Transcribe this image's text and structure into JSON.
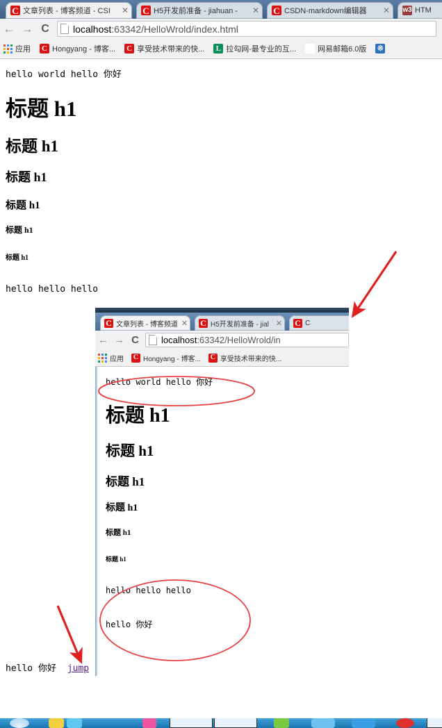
{
  "browser": {
    "tabs": [
      {
        "title": "文章列表 - 博客频道 - CSI",
        "icon": "csdn-favicon",
        "close": "✕",
        "active": true
      },
      {
        "title": "H5开发前准备 - jiahuan -",
        "icon": "csdn-favicon",
        "close": "✕",
        "active": false
      },
      {
        "title": "CSDN-markdown编辑器",
        "icon": "csdn-favicon",
        "close": "✕",
        "active": false
      },
      {
        "title": "HTM",
        "icon": "w3-favicon",
        "close": "✕",
        "active": false
      }
    ],
    "nav": {
      "back": "←",
      "forward": "→",
      "reload": "C"
    },
    "url_host": "localhost",
    "url_path": ":63342/HelloWrold/index.html",
    "url_full": "localhost:63342/HelloWrold/index.html",
    "bookmarks": [
      {
        "label": "应用",
        "icon": "apps-grid-icon"
      },
      {
        "label": "Hongyang - 博客...",
        "icon": "csdn-favicon"
      },
      {
        "label": "享受技术带来的快...",
        "icon": "csdn-favicon"
      },
      {
        "label": "拉勾网-最专业的互...",
        "icon": "lagou-favicon"
      },
      {
        "label": "网易邮箱6.0版",
        "icon": "netease-favicon"
      },
      {
        "label": "",
        "icon": "blue-favicon"
      }
    ]
  },
  "page": {
    "intro": "hello world hello 你好",
    "headings": [
      {
        "text": "标题 h1",
        "level": 1
      },
      {
        "text": "标题 h1",
        "level": 2
      },
      {
        "text": "标题 h1",
        "level": 3
      },
      {
        "text": "标题 h1",
        "level": 4
      },
      {
        "text": "标题 h1",
        "level": 5
      },
      {
        "text": "标题 h1",
        "level": 6
      }
    ],
    "para1": "hello hello hello",
    "footer_text": "hello 你好",
    "footer_link": "jump"
  },
  "inner_screenshot": {
    "tabs": [
      {
        "title": "文章列表 - 博客频道",
        "icon": "csdn-favicon",
        "close": "✕",
        "active": true
      },
      {
        "title": "H5开发前准备 - jial",
        "icon": "csdn-favicon",
        "close": "✕",
        "active": false
      },
      {
        "title": "C",
        "icon": "csdn-favicon",
        "close": "",
        "active": false
      }
    ],
    "nav": {
      "back": "←",
      "forward": "→",
      "reload": "C"
    },
    "url_host": "localhost",
    "url_path": ":63342/HelloWrold/in",
    "bookmarks": [
      {
        "label": "应用",
        "icon": "apps-grid-icon"
      },
      {
        "label": "Hongyang - 博客...",
        "icon": "csdn-favicon"
      },
      {
        "label": "享受技术带来的快...",
        "icon": "csdn-favicon"
      }
    ],
    "intro": "hello world hello 你好",
    "headings": [
      {
        "text": "标题 h1",
        "level": 1
      },
      {
        "text": "标题 h1",
        "level": 2
      },
      {
        "text": "标题 h1",
        "level": 3
      },
      {
        "text": "标题 h1",
        "level": 4
      },
      {
        "text": "标题 h1",
        "level": 5
      },
      {
        "text": "标题 h1",
        "level": 6
      }
    ],
    "para1": "hello hello hello",
    "para2": "hello 你好"
  },
  "annotations": {
    "arrow_top_color": "#e02020",
    "arrow_bottom_color": "#e02020",
    "ellipse_color": "#e84040",
    "link_color": "#551a8b"
  },
  "colors": {
    "chrome_tabstrip": "#4d719c",
    "toolbar_bg": "#f1f1f1",
    "taskbar": "#2f95cf",
    "csdn_red": "#dd1111",
    "lagou_green": "#0a8f5b"
  }
}
